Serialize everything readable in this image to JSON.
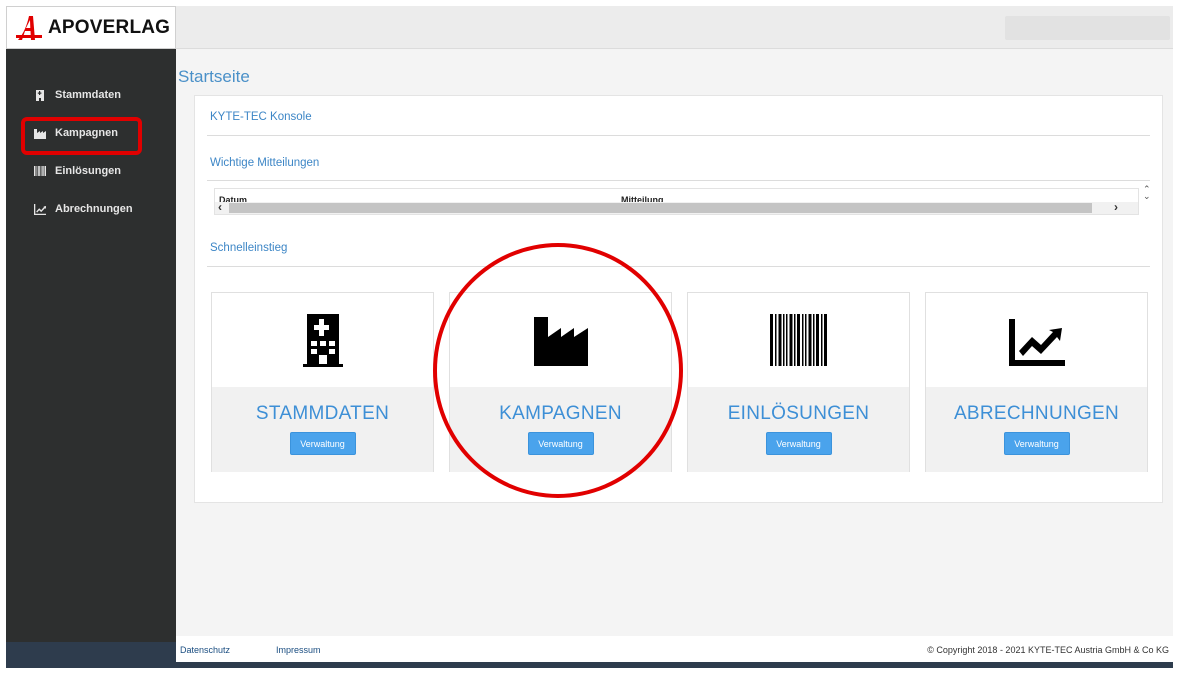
{
  "brand": {
    "name": "APOVERLAG",
    "logo_color": "#e10000"
  },
  "sidebar": {
    "items": [
      {
        "label": "Stammdaten",
        "icon": "building-icon"
      },
      {
        "label": "Kampagnen",
        "icon": "factory-icon"
      },
      {
        "label": "Einlösungen",
        "icon": "barcode-icon"
      },
      {
        "label": "Abrechnungen",
        "icon": "chart-line-icon"
      }
    ]
  },
  "main": {
    "page_title": "Startseite",
    "console_title": "KYTE-TEC Konsole",
    "notices_title": "Wichtige Mitteilungen",
    "notices_table": {
      "columns": [
        "Datum",
        "Mitteilung"
      ]
    },
    "quick_title": "Schnelleinstieg",
    "cards": [
      {
        "title": "STAMMDATEN",
        "button": "Verwaltung",
        "icon": "building-icon"
      },
      {
        "title": "KAMPAGNEN",
        "button": "Verwaltung",
        "icon": "factory-icon"
      },
      {
        "title": "EINLÖSUNGEN",
        "button": "Verwaltung",
        "icon": "barcode-icon"
      },
      {
        "title": "ABRECHNUNGEN",
        "button": "Verwaltung",
        "icon": "chart-line-icon"
      }
    ]
  },
  "footer": {
    "links": [
      "Datenschutz",
      "Impressum"
    ],
    "copyright": "© Copyright 2018 - 2021 KYTE-TEC Austria GmbH & Co KG"
  },
  "colors": {
    "accent": "#3d8fd6",
    "button": "#4aa3ec",
    "sidebar": "#2d2f2f",
    "annotation": "#e10000"
  }
}
